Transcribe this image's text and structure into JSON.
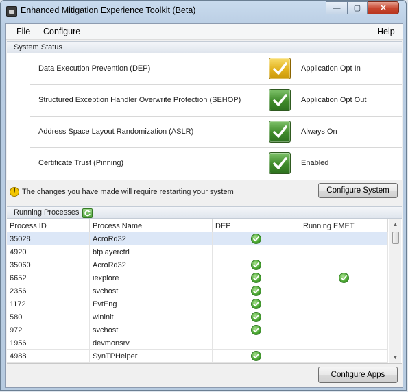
{
  "window": {
    "title": "Enhanced Mitigation Experience Toolkit (Beta)",
    "controls": {
      "minimize": "—",
      "maximize": "▢",
      "close": "✕"
    }
  },
  "menu": {
    "file": "File",
    "configure": "Configure",
    "help": "Help"
  },
  "system_status": {
    "header": "System Status",
    "items": [
      {
        "feature": "Data Execution Prevention (DEP)",
        "value": "Application Opt In",
        "state": "warning"
      },
      {
        "feature": "Structured Exception Handler Overwrite Protection (SEHOP)",
        "value": "Application Opt Out",
        "state": "ok"
      },
      {
        "feature": "Address Space Layout Randomization (ASLR)",
        "value": "Always On",
        "state": "ok"
      },
      {
        "feature": "Certificate Trust (Pinning)",
        "value": "Enabled",
        "state": "ok"
      }
    ],
    "restart_notice": "The changes you have made will require restarting your system",
    "configure_button": "Configure System"
  },
  "processes": {
    "header": "Running Processes",
    "columns": [
      "Process ID",
      "Process Name",
      "DEP",
      "Running EMET"
    ],
    "rows": [
      {
        "pid": "35028",
        "name": "AcroRd32",
        "dep": true,
        "emet": false
      },
      {
        "pid": "4920",
        "name": "btplayerctrl",
        "dep": false,
        "emet": false
      },
      {
        "pid": "35060",
        "name": "AcroRd32",
        "dep": true,
        "emet": false
      },
      {
        "pid": "6652",
        "name": "iexplore",
        "dep": true,
        "emet": true
      },
      {
        "pid": "2356",
        "name": "svchost",
        "dep": true,
        "emet": false
      },
      {
        "pid": "1172",
        "name": "EvtEng",
        "dep": true,
        "emet": false
      },
      {
        "pid": "580",
        "name": "wininit",
        "dep": true,
        "emet": false
      },
      {
        "pid": "972",
        "name": "svchost",
        "dep": true,
        "emet": false
      },
      {
        "pid": "1956",
        "name": "devmonsrv",
        "dep": false,
        "emet": false
      },
      {
        "pid": "4988",
        "name": "SynTPHelper",
        "dep": true,
        "emet": false
      }
    ],
    "configure_button": "Configure Apps"
  },
  "colors": {
    "ok": "#3f8a2a",
    "warning": "#e2b21e",
    "selected_row": "#dce7f7"
  },
  "icons": {
    "app": "emet-app-icon",
    "refresh": "refresh-icon",
    "warning": "warning-icon",
    "check": "check-icon"
  }
}
